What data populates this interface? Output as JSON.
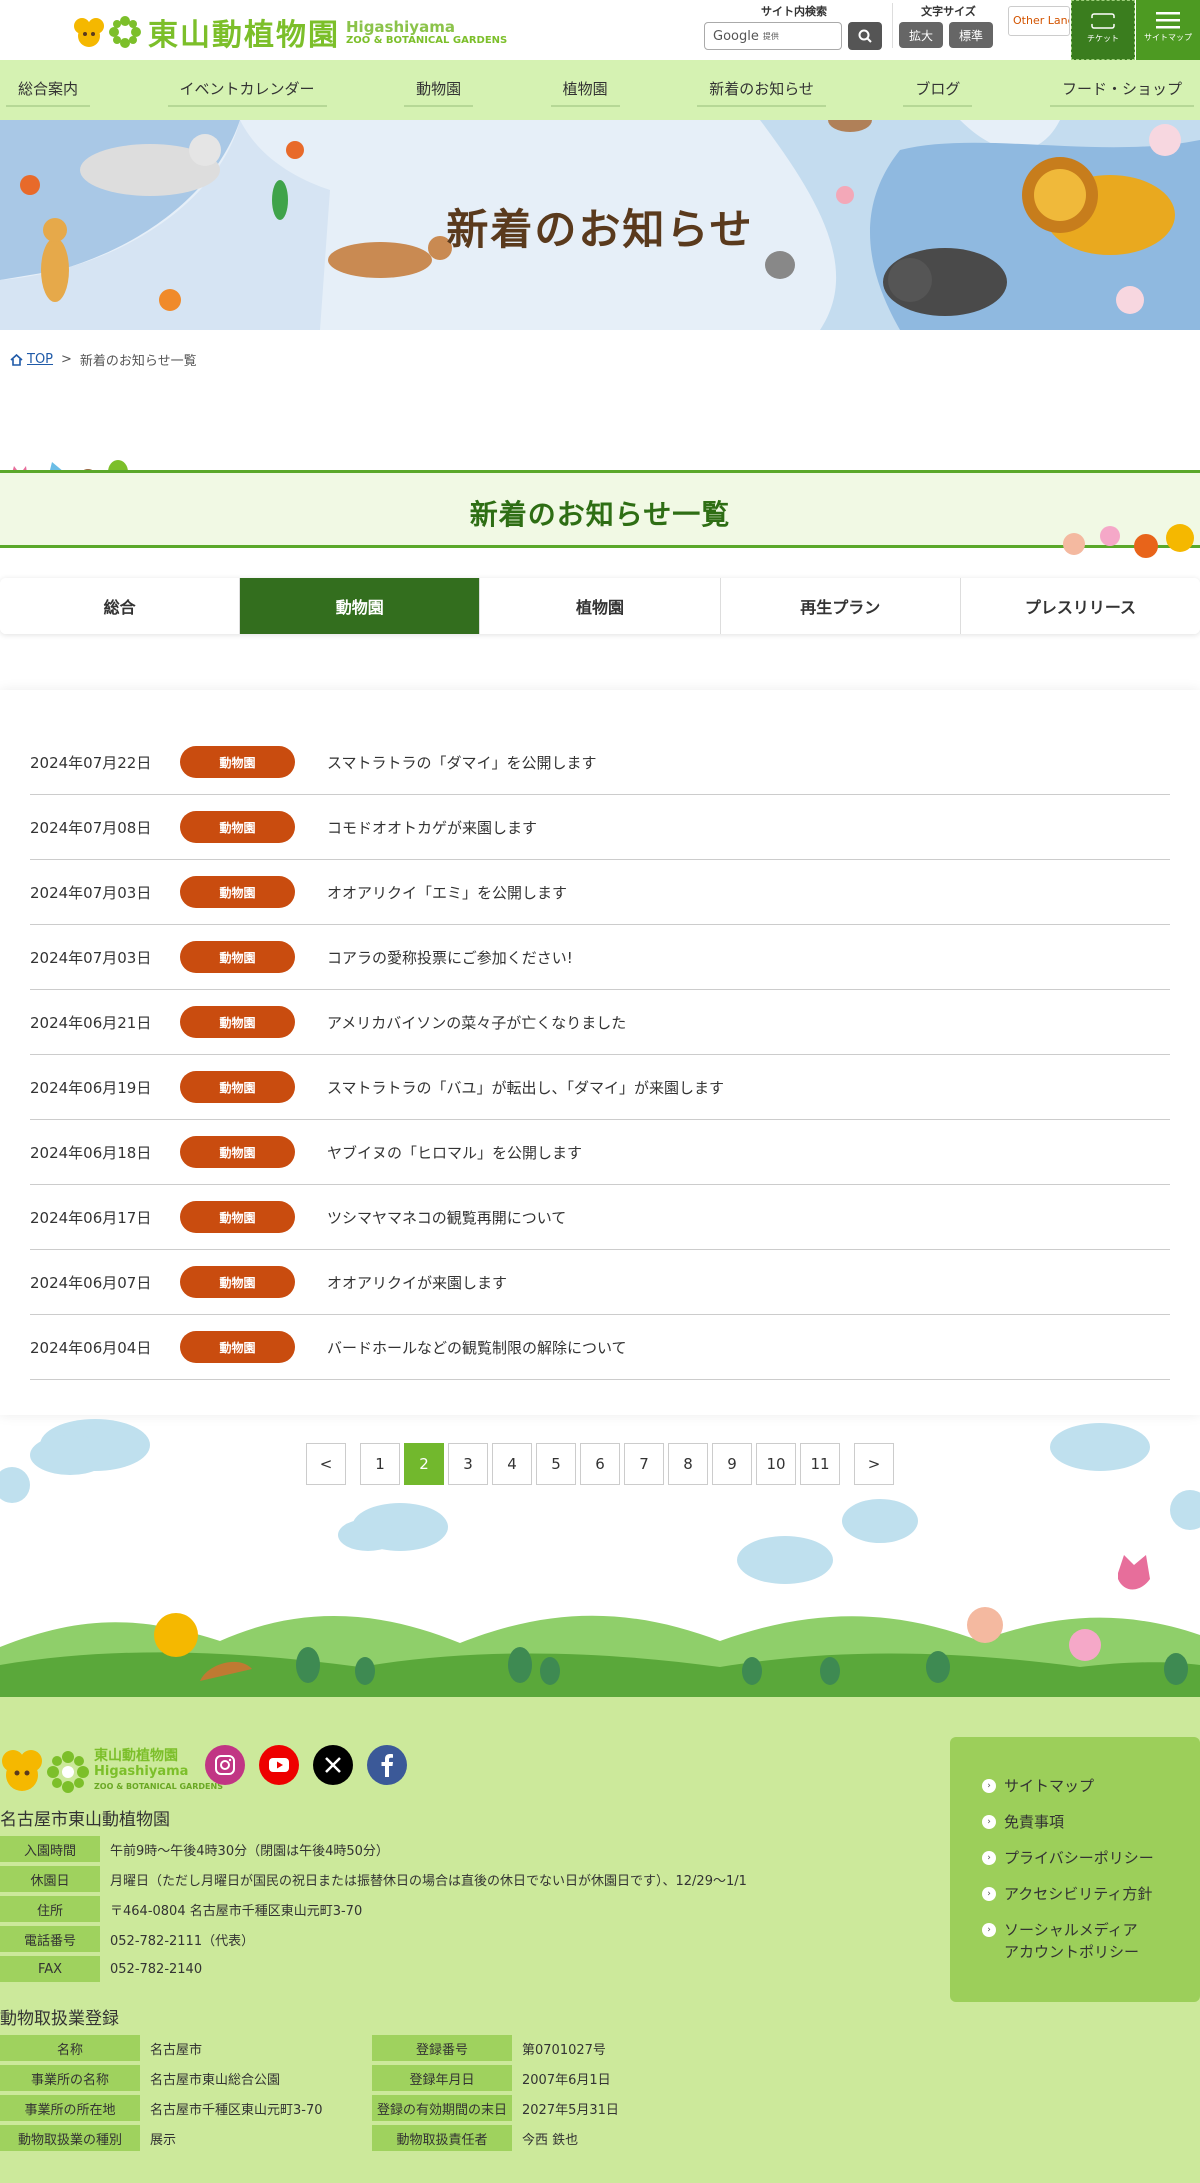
{
  "header": {
    "logo_jp": "東山動植物園",
    "logo_en_1": "Higashiyama",
    "logo_en_2": "ZOO & BOTANICAL GARDENS",
    "search_heading": "サイト内検索",
    "search_placeholder": "Google",
    "search_provider": "提供",
    "fontsize_heading": "文字サイズ",
    "fontsize_enlarge": "拡大",
    "fontsize_standard": "標準",
    "language": "Other Languages",
    "ticket_label": "チケット",
    "sitemap_label": "サイトマップ"
  },
  "nav": {
    "items": [
      "総合案内",
      "イベントカレンダー",
      "動物園",
      "植物園",
      "新着のお知らせ",
      "ブログ",
      "フード・ショップ"
    ]
  },
  "hero": {
    "title": "新着のお知らせ"
  },
  "breadcrumb": {
    "home": "TOP",
    "separator": ">",
    "current": "新着のお知らせ一覧"
  },
  "section": {
    "title": "新着のお知らせ一覧"
  },
  "tabs": {
    "items": [
      "総合",
      "動物園",
      "植物園",
      "再生プラン",
      "プレスリリース"
    ],
    "active_index": 1
  },
  "news": {
    "badge_color": "#c94c0f",
    "items": [
      {
        "date": "2024年07月22日",
        "badge": "動物園",
        "title": "スマトラトラの「ダマイ」を公開します"
      },
      {
        "date": "2024年07月08日",
        "badge": "動物園",
        "title": "コモドオオトカゲが来園します"
      },
      {
        "date": "2024年07月03日",
        "badge": "動物園",
        "title": "オオアリクイ「エミ」を公開します"
      },
      {
        "date": "2024年07月03日",
        "badge": "動物園",
        "title": "コアラの愛称投票にご参加ください!"
      },
      {
        "date": "2024年06月21日",
        "badge": "動物園",
        "title": "アメリカバイソンの菜々子が亡くなりました"
      },
      {
        "date": "2024年06月19日",
        "badge": "動物園",
        "title": "スマトラトラの「バユ」が転出し、「ダマイ」が来園します"
      },
      {
        "date": "2024年06月18日",
        "badge": "動物園",
        "title": "ヤブイヌの「ヒロマル」を公開します"
      },
      {
        "date": "2024年06月17日",
        "badge": "動物園",
        "title": "ツシマヤマネコの観覧再開について"
      },
      {
        "date": "2024年06月07日",
        "badge": "動物園",
        "title": "オオアリクイが来園します"
      },
      {
        "date": "2024年06月04日",
        "badge": "動物園",
        "title": "バードホールなどの観覧制限の解除について"
      }
    ]
  },
  "pager": {
    "prev": "<",
    "next": ">",
    "pages": [
      "1",
      "2",
      "3",
      "4",
      "5",
      "6",
      "7",
      "8",
      "9",
      "10",
      "11"
    ],
    "current": "2"
  },
  "footer": {
    "logo_jp": "東山動植物園",
    "logo_en_1": "Higashiyama",
    "logo_en_2": "ZOO & BOTANICAL GARDENS",
    "org_name": "名古屋市東山動植物園",
    "info": [
      {
        "label": "入園時間",
        "value": "午前9時～午後4時30分（閉園は午後4時50分）"
      },
      {
        "label": "休園日",
        "value": "月曜日（ただし月曜日が国民の祝日または振替休日の場合は直後の休日でない日が休園日です）、12/29～1/1"
      },
      {
        "label": "住所",
        "value": "〒464-0804 名古屋市千種区東山元町3-70"
      },
      {
        "label": "電話番号",
        "value": "052-782-2111（代表）"
      },
      {
        "label": "FAX",
        "value": "052-782-2140"
      }
    ],
    "reg_title": "動物取扱業登録",
    "reg": [
      {
        "label": "名称",
        "value": "名古屋市",
        "label2": "登録番号",
        "value2": "第0701027号"
      },
      {
        "label": "事業所の名称",
        "value": "名古屋市東山総合公園",
        "label2": "登録年月日",
        "value2": "2007年6月1日"
      },
      {
        "label": "事業所の所在地",
        "value": "名古屋市千種区東山元町3-70",
        "label2": "登録の有効期間の末日",
        "value2": "2027年5月31日"
      },
      {
        "label": "動物取扱業の種別",
        "value": "展示",
        "label2": "動物取扱責任者",
        "value2": "今西 鉄也"
      }
    ],
    "links": [
      "サイトマップ",
      "免責事項",
      "プライバシーポリシー",
      "アクセシビリティ方針",
      "ソーシャルメディア\nアカウントポリシー"
    ],
    "social_icons": [
      "instagram-icon",
      "youtube-icon",
      "x-icon",
      "facebook-icon"
    ]
  }
}
